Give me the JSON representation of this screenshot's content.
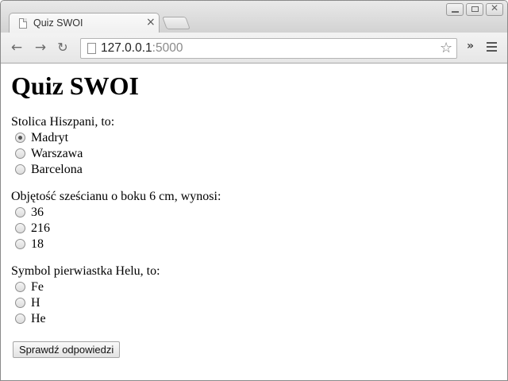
{
  "browser": {
    "tab_title": "Quiz SWOI",
    "tab_close": "×",
    "url_host": "127.0.0.1",
    "url_port": ":5000"
  },
  "page": {
    "title": "Quiz SWOI",
    "questions": [
      {
        "text": "Stolica Hiszpani, to:",
        "options": [
          "Madryt",
          "Warszawa",
          "Barcelona"
        ],
        "selected": "Madryt"
      },
      {
        "text": "Objętość sześcianu o boku 6 cm, wynosi:",
        "options": [
          "36",
          "216",
          "18"
        ],
        "selected": null
      },
      {
        "text": "Symbol pierwiastka Helu, to:",
        "options": [
          "Fe",
          "H",
          "He"
        ],
        "selected": null
      }
    ],
    "submit_label": "Sprawdź odpowiedzi"
  }
}
